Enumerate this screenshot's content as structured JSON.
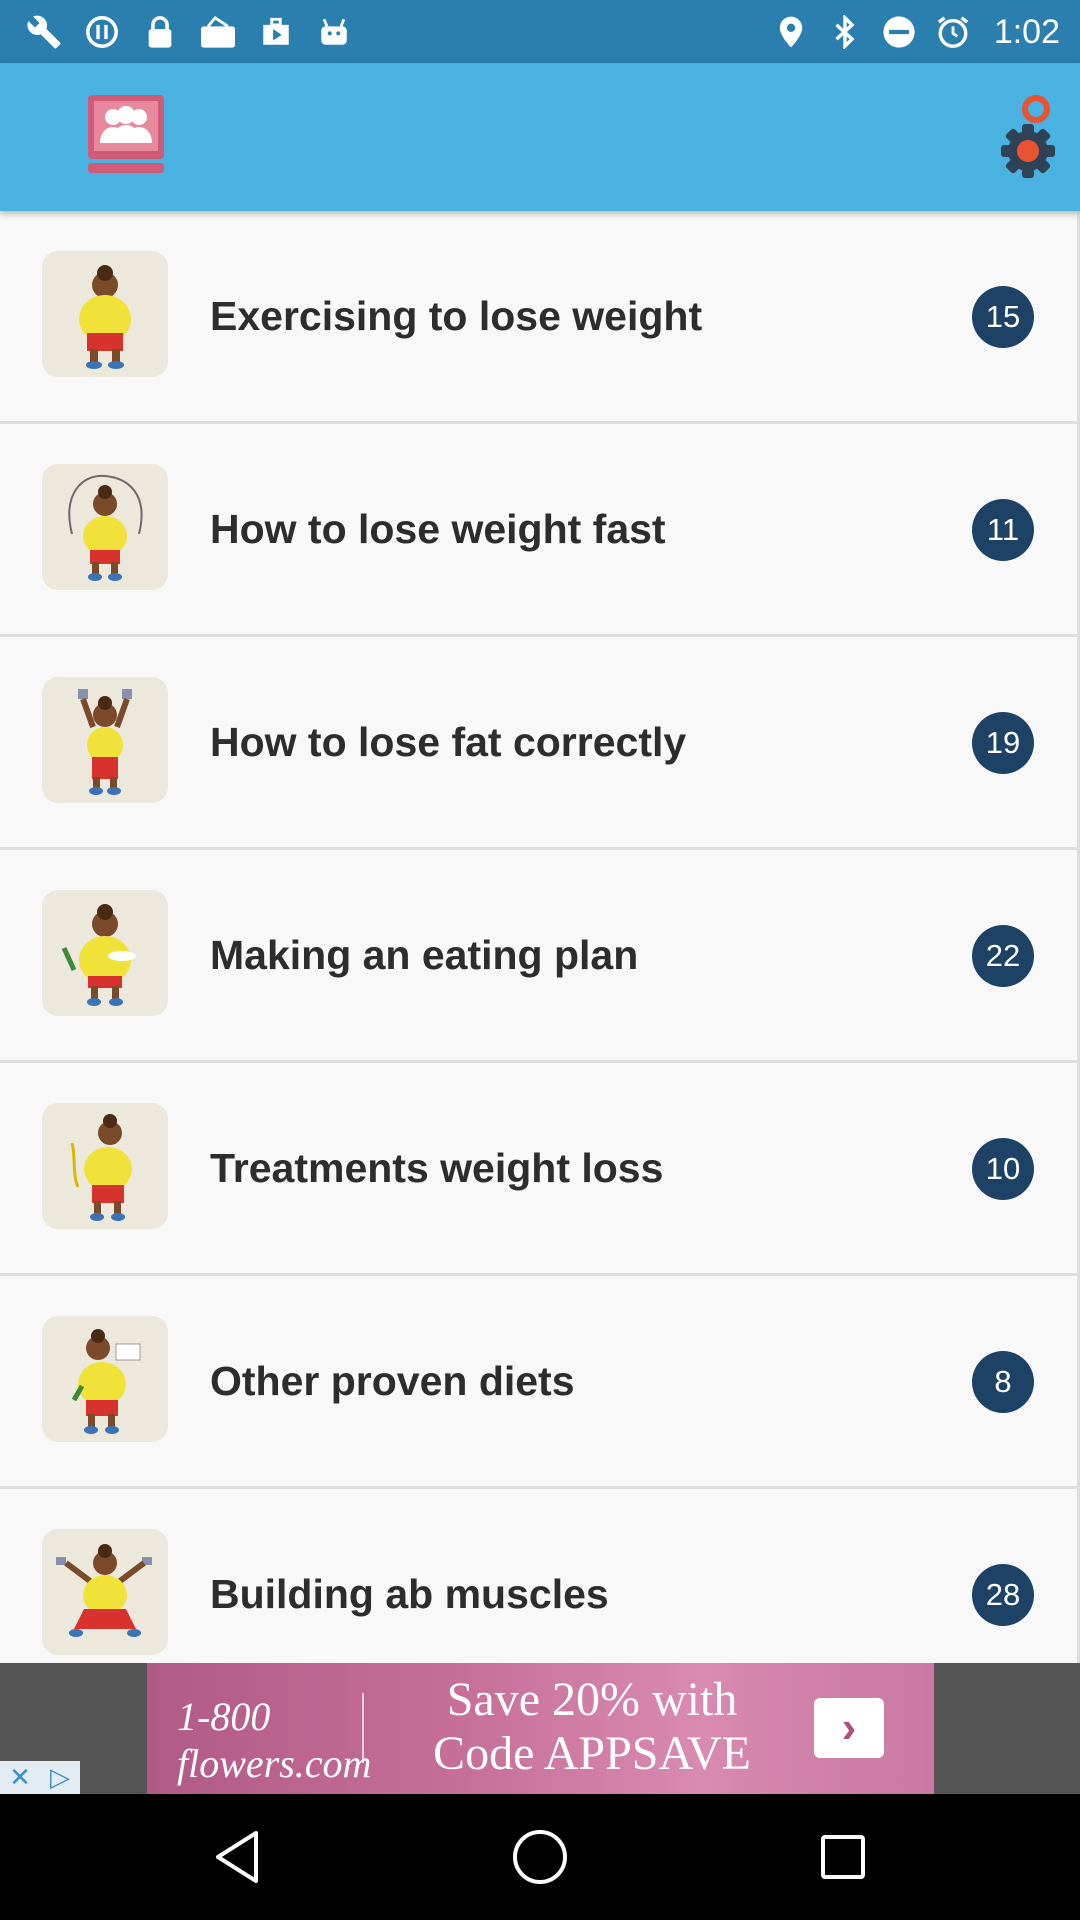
{
  "status_bar": {
    "time": "1:02",
    "left_icons": [
      "wrench-icon",
      "sync-icon",
      "lock-icon",
      "mail-icon",
      "play-store-icon",
      "android-icon"
    ],
    "right_icons": [
      "location-icon",
      "bluetooth-icon",
      "dnd-icon",
      "alarm-icon"
    ]
  },
  "app_bar": {
    "logo_icon": "community-icon",
    "settings_icon": "settings-gear-icon",
    "accent_color": "#49b2e0"
  },
  "list": {
    "items": [
      {
        "title": "Exercising to lose weight",
        "count": "15"
      },
      {
        "title": "How to lose weight fast",
        "count": "11"
      },
      {
        "title": "How to lose fat correctly",
        "count": "19"
      },
      {
        "title": "Making an eating plan",
        "count": "22"
      },
      {
        "title": "Treatments weight loss",
        "count": "10"
      },
      {
        "title": "Other proven diets",
        "count": "8"
      },
      {
        "title": "Building ab muscles",
        "count": "28"
      }
    ],
    "badge_color": "#1d4266"
  },
  "ad": {
    "brand": "1-800 flowers.com",
    "line1": "Save 20% with",
    "line2": "Code APPSAVE"
  },
  "nav_bar": {
    "buttons": [
      "back-icon",
      "home-icon",
      "recents-icon"
    ]
  }
}
